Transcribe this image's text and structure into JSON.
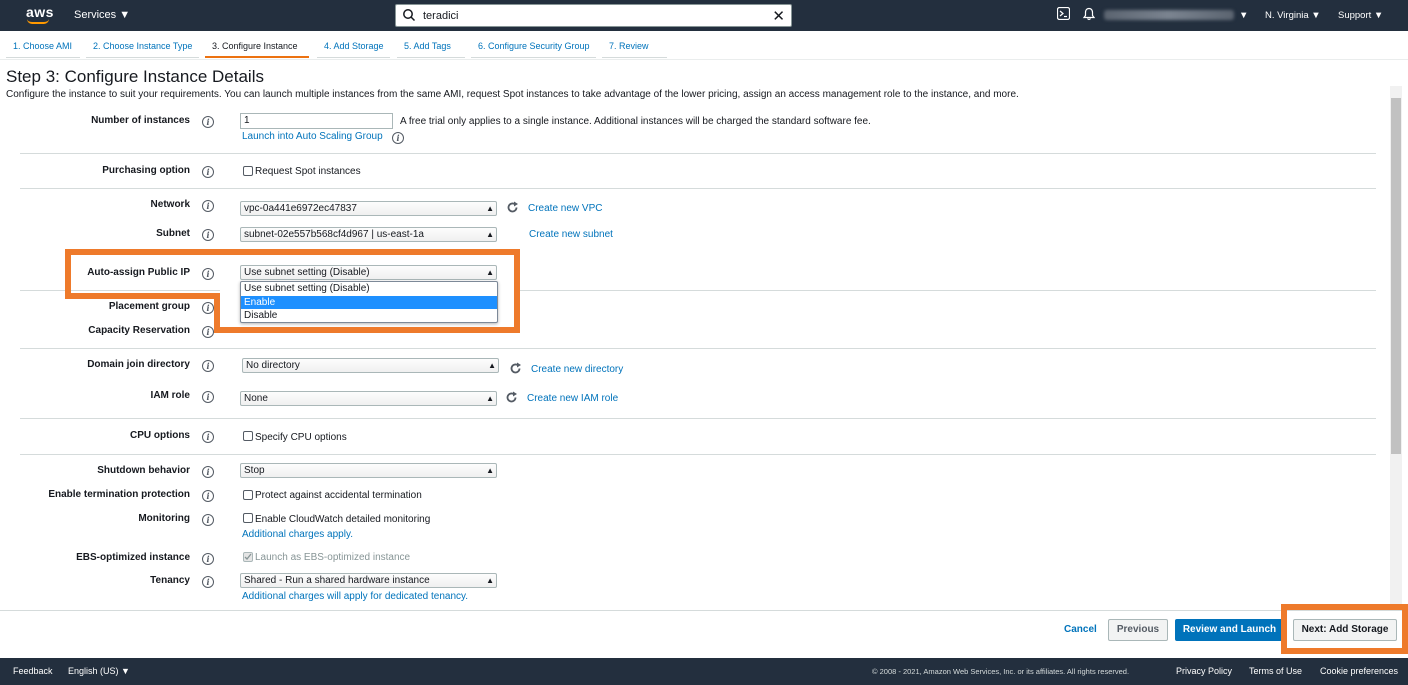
{
  "topbar": {
    "logo": "aws",
    "services": "Services",
    "search_value": "teradici",
    "region": "N. Virginia",
    "support": "Support",
    "icons": [
      "search-icon",
      "close-icon",
      "cloudshell-icon",
      "bell-icon"
    ]
  },
  "tabs": [
    {
      "label": "1. Choose AMI"
    },
    {
      "label": "2. Choose Instance Type"
    },
    {
      "label": "3. Configure Instance"
    },
    {
      "label": "4. Add Storage"
    },
    {
      "label": "5. Add Tags"
    },
    {
      "label": "6. Configure Security Group"
    },
    {
      "label": "7. Review"
    }
  ],
  "page": {
    "title": "Step 3: Configure Instance Details",
    "description": "Configure the instance to suit your requirements. You can launch multiple instances from the same AMI, request Spot instances to take advantage of the lower pricing, assign an access management role to the instance, and more."
  },
  "form": {
    "num_instances": {
      "label": "Number of instances",
      "value": "1",
      "note": "A free trial only applies to a single instance. Additional instances will be charged the standard software fee.",
      "link": "Launch into Auto Scaling Group"
    },
    "purchasing": {
      "label": "Purchasing option",
      "checkbox": "Request Spot instances"
    },
    "network": {
      "label": "Network",
      "value": "vpc-0a441e6972ec47837",
      "link": "Create new VPC"
    },
    "subnet": {
      "label": "Subnet",
      "value": "subnet-02e557b568cf4d967 | us-east-1a",
      "link": "Create new subnet"
    },
    "public_ip": {
      "label": "Auto-assign Public IP",
      "value": "Use subnet setting (Disable)",
      "options": [
        "Use subnet setting (Disable)",
        "Enable",
        "Disable"
      ]
    },
    "placement": {
      "label": "Placement group"
    },
    "capacity": {
      "label": "Capacity Reservation"
    },
    "domain": {
      "label": "Domain join directory",
      "value": "No directory",
      "link": "Create new directory"
    },
    "iam": {
      "label": "IAM role",
      "value": "None",
      "link": "Create new IAM role"
    },
    "cpu": {
      "label": "CPU options",
      "checkbox": "Specify CPU options"
    },
    "shutdown": {
      "label": "Shutdown behavior",
      "value": "Stop"
    },
    "termination": {
      "label": "Enable termination protection",
      "checkbox": "Protect against accidental termination"
    },
    "monitoring": {
      "label": "Monitoring",
      "checkbox": "Enable CloudWatch detailed monitoring",
      "link": "Additional charges apply."
    },
    "ebs": {
      "label": "EBS-optimized instance",
      "checkbox": "Launch as EBS-optimized instance"
    },
    "tenancy": {
      "label": "Tenancy",
      "value": "Shared - Run a shared hardware instance",
      "link": "Additional charges will apply for dedicated tenancy."
    }
  },
  "buttons": {
    "cancel": "Cancel",
    "previous": "Previous",
    "review": "Review and Launch",
    "next": "Next: Add Storage"
  },
  "footer": {
    "feedback": "Feedback",
    "language": "English (US)",
    "copyright": "© 2008 - 2021, Amazon Web Services, Inc. or its affiliates. All rights reserved.",
    "privacy": "Privacy Policy",
    "terms": "Terms of Use",
    "cookies": "Cookie preferences"
  },
  "colors": {
    "nav_bg": "#232f3e",
    "link": "#0073bb",
    "primary": "#0073bb",
    "highlight": "#ee7a2b",
    "selected_option": "#1e90ff"
  }
}
